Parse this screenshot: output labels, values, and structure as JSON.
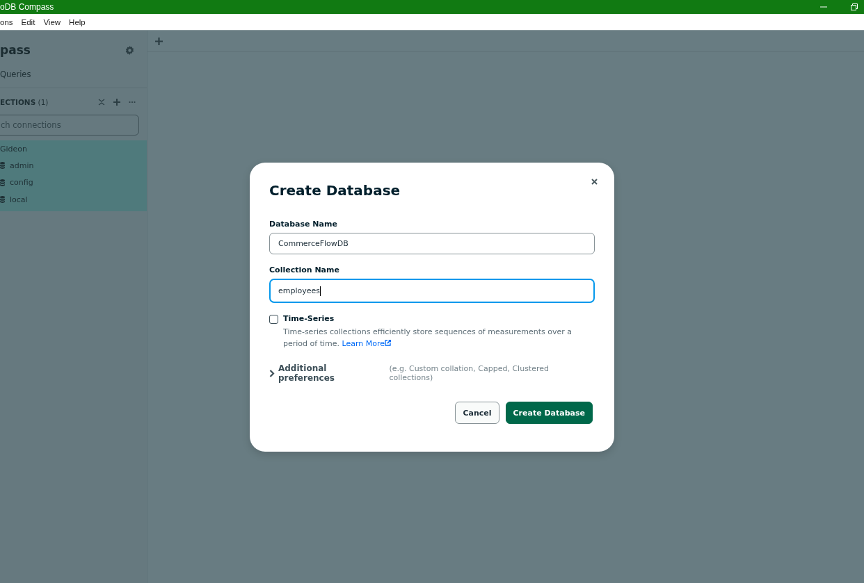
{
  "window": {
    "title": "oDB Compass"
  },
  "menu": [
    "ons",
    "Edit",
    "View",
    "Help"
  ],
  "sidebar": {
    "title": "pass",
    "queries": "Queries",
    "connections_label": "ECTIONS",
    "connections_count": "(1)",
    "search": {
      "placeholder": "ch connections"
    },
    "tree": [
      {
        "label": "Gideon",
        "selected": true,
        "children": [
          {
            "label": "admin"
          },
          {
            "label": "config"
          },
          {
            "label": "local"
          }
        ]
      }
    ]
  },
  "dialog": {
    "title": "Create Database",
    "fields": [
      {
        "label": "Database Name",
        "value": "CommerceFlowDB",
        "focused": false
      },
      {
        "label": "Collection Name",
        "value": "employees",
        "focused": true
      }
    ],
    "time_series": {
      "label": "Time-Series",
      "checked": false,
      "description": "Time-series collections efficiently store sequences of measurements over a period of time.",
      "link": "Learn More"
    },
    "additional": {
      "label": "Additional preferences",
      "hint": "(e.g. Custom collation, Capped, Clustered collections)",
      "expanded": false
    },
    "buttons": [
      {
        "label": "Cancel",
        "kind": "secondary"
      },
      {
        "label": "Create Database",
        "kind": "primary"
      }
    ]
  }
}
